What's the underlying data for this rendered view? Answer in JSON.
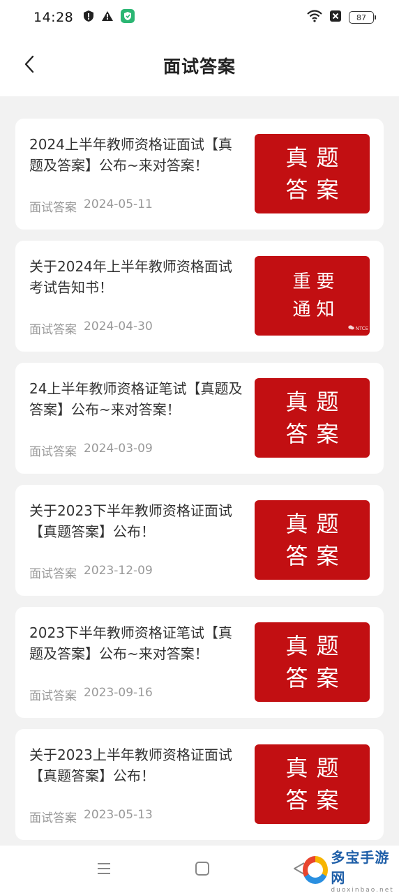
{
  "status_bar": {
    "time": "14:28",
    "battery": "87",
    "left_icons": [
      "shield-alert-icon",
      "warning-icon",
      "security-app-icon"
    ],
    "right_icons": [
      "wifi-icon",
      "no-sim-icon",
      "battery-icon"
    ]
  },
  "header": {
    "title": "面试答案",
    "back_icon": "chevron-left-icon"
  },
  "articles": [
    {
      "title": "2024上半年教师资格证面试【真题及答案】公布~来对答案！",
      "category": "面试答案",
      "date": "2024-05-11",
      "thumb_lines": [
        "真题",
        "答案"
      ]
    },
    {
      "title": "关于2024年上半年教师资格面试考试告知书！",
      "category": "面试答案",
      "date": "2024-04-30",
      "thumb_lines": [
        "重要",
        "通知"
      ],
      "thumb_mark": "NTCE"
    },
    {
      "title": "24上半年教师资格证笔试【真题及答案】公布~来对答案！",
      "category": "面试答案",
      "date": "2024-03-09",
      "thumb_lines": [
        "真题",
        "答案"
      ]
    },
    {
      "title": "关于2023下半年教师资格证面试【真题答案】公布！",
      "category": "面试答案",
      "date": "2023-12-09",
      "thumb_lines": [
        "真题",
        "答案"
      ]
    },
    {
      "title": "2023下半年教师资格证笔试【真题及答案】公布~来对答案！",
      "category": "面试答案",
      "date": "2023-09-16",
      "thumb_lines": [
        "真题",
        "答案"
      ]
    },
    {
      "title": "关于2023上半年教师资格证面试【真题答案】公布！",
      "category": "面试答案",
      "date": "2023-05-13",
      "thumb_lines": [
        "真题",
        "答案"
      ]
    }
  ],
  "system_nav": {
    "icons": [
      "menu-icon",
      "home-icon",
      "back-icon"
    ]
  },
  "watermark": {
    "name": "多宝手游网",
    "domain": "duoxinbao.net"
  },
  "colors": {
    "thumb_red": "#c20f12",
    "background": "#f2f2f2",
    "meta_gray": "#999999"
  }
}
